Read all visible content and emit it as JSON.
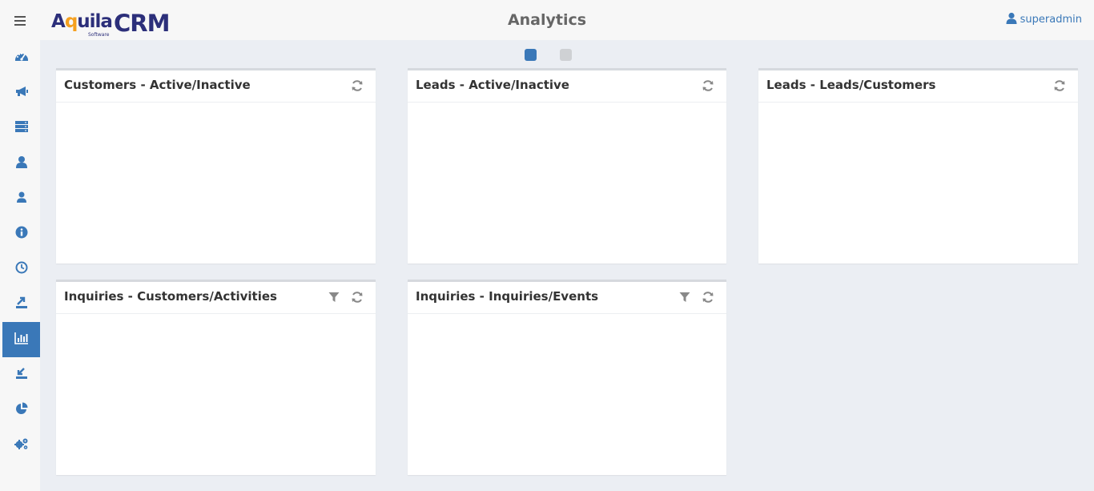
{
  "app": {
    "logo": {
      "brand_a": "A",
      "brand_q": "q",
      "brand_rest": "uila",
      "subtitle": "Software",
      "product": "CRM"
    },
    "page_title": "Analytics",
    "user": {
      "name": "superadmin",
      "icon": "user-icon"
    }
  },
  "colors": {
    "accent": "#3a78b8",
    "logo_navy": "#2c2f7a",
    "logo_orange": "#f5a01f",
    "dot_inactive": "#cfd1d4"
  },
  "sidebar": {
    "items": [
      {
        "icon": "dashboard-icon",
        "active": false
      },
      {
        "icon": "megaphone-icon",
        "active": false
      },
      {
        "icon": "list-icon",
        "active": false
      },
      {
        "icon": "user-icon",
        "active": false
      },
      {
        "icon": "contact-icon",
        "active": false
      },
      {
        "icon": "info-icon",
        "active": false
      },
      {
        "icon": "clock-icon",
        "active": false
      },
      {
        "icon": "export-icon",
        "active": false
      },
      {
        "icon": "bar-chart-icon",
        "active": true
      },
      {
        "icon": "import-icon",
        "active": false
      },
      {
        "icon": "pie-chart-icon",
        "active": false
      },
      {
        "icon": "settings-icon",
        "active": false
      }
    ]
  },
  "pager": {
    "pages": 2,
    "current": 1
  },
  "panels": [
    {
      "title": "Customers - Active/Inactive",
      "tools": [
        "refresh-icon"
      ]
    },
    {
      "title": "Leads - Active/Inactive",
      "tools": [
        "refresh-icon"
      ]
    },
    {
      "title": "Leads - Leads/Customers",
      "tools": [
        "refresh-icon"
      ]
    },
    {
      "title": "Inquiries - Customers/Activities",
      "tools": [
        "filter-icon",
        "refresh-icon"
      ]
    },
    {
      "title": "Inquiries - Inquiries/Events",
      "tools": [
        "filter-icon",
        "refresh-icon"
      ]
    }
  ]
}
